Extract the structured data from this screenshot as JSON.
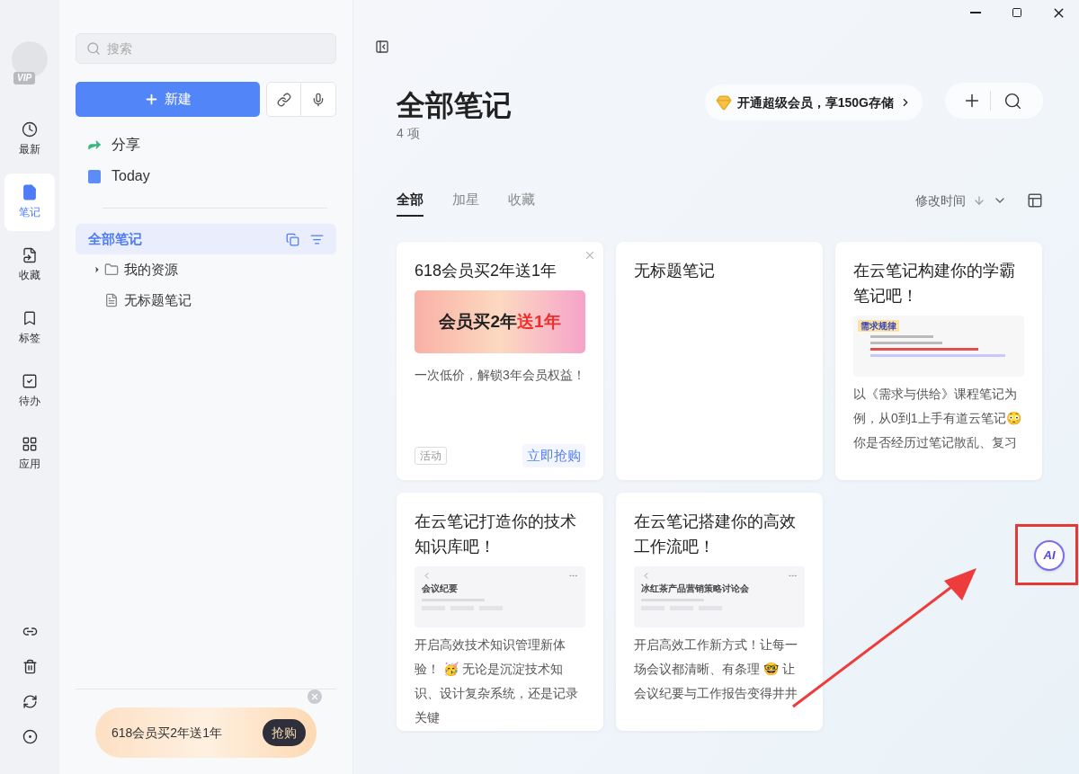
{
  "rail": {
    "vip_badge": "VIP",
    "items": [
      {
        "label": "最新",
        "selected": false
      },
      {
        "label": "笔记",
        "selected": true
      },
      {
        "label": "收藏",
        "selected": false
      },
      {
        "label": "标签",
        "selected": false
      },
      {
        "label": "待办",
        "selected": false
      },
      {
        "label": "应用",
        "selected": false
      }
    ]
  },
  "sidebar": {
    "search": {
      "placeholder": "搜索"
    },
    "new_button": "新建",
    "quick": [
      {
        "label": "分享"
      },
      {
        "label": "Today"
      }
    ],
    "tree": [
      {
        "label": "全部笔记",
        "selected": true,
        "children": [
          {
            "label": "我的资源",
            "kind": "folder",
            "expanded": false,
            "selected": false
          },
          {
            "label": "无标题笔记",
            "kind": "note",
            "selected": false
          }
        ]
      }
    ],
    "promo": {
      "text": "618会员买2年送1年",
      "button": "抢购"
    }
  },
  "main": {
    "title": "全部笔记",
    "count": "4 项",
    "vip_offer": "开通超级会员，享150G存储",
    "tabs": [
      {
        "label": "全部",
        "selected": true
      },
      {
        "label": "加星",
        "selected": false
      },
      {
        "label": "收藏",
        "selected": false
      }
    ],
    "sort": {
      "label": "修改时间"
    },
    "cards": [
      {
        "kind": "promo",
        "title": "618会员买2年送1年",
        "banner_text": "会员买2年",
        "banner_highlight": "送1年",
        "body": "一次低价，解锁3年会员权益！",
        "tag": "活动",
        "action": "立即抢购"
      },
      {
        "kind": "empty",
        "title": "无标题笔记"
      },
      {
        "kind": "slide",
        "title": "在云笔记构建你的学霸笔记吧！",
        "preview_title": "需求规律",
        "body": "以《需求与供给》课程笔记为例，从0到1上手有道云笔记😳你是否经历过笔记散乱、复习"
      },
      {
        "kind": "app",
        "title": "在云笔记打造你的技术知识库吧！",
        "preview_title": "会议纪要",
        "body": "开启高效技术知识管理新体验！ 🥳 无论是沉淀技术知识、设计复杂系统，还是记录关键"
      },
      {
        "kind": "app",
        "title": "在云笔记搭建你的高效工作流吧！",
        "preview_title": "冰红茶产品营销策略讨论会",
        "body": "开启高效工作新方式！让每一场会议都清晰、有条理 🤓 让会议纪要与工作报告变得井井"
      }
    ],
    "ai_button": "AI"
  }
}
